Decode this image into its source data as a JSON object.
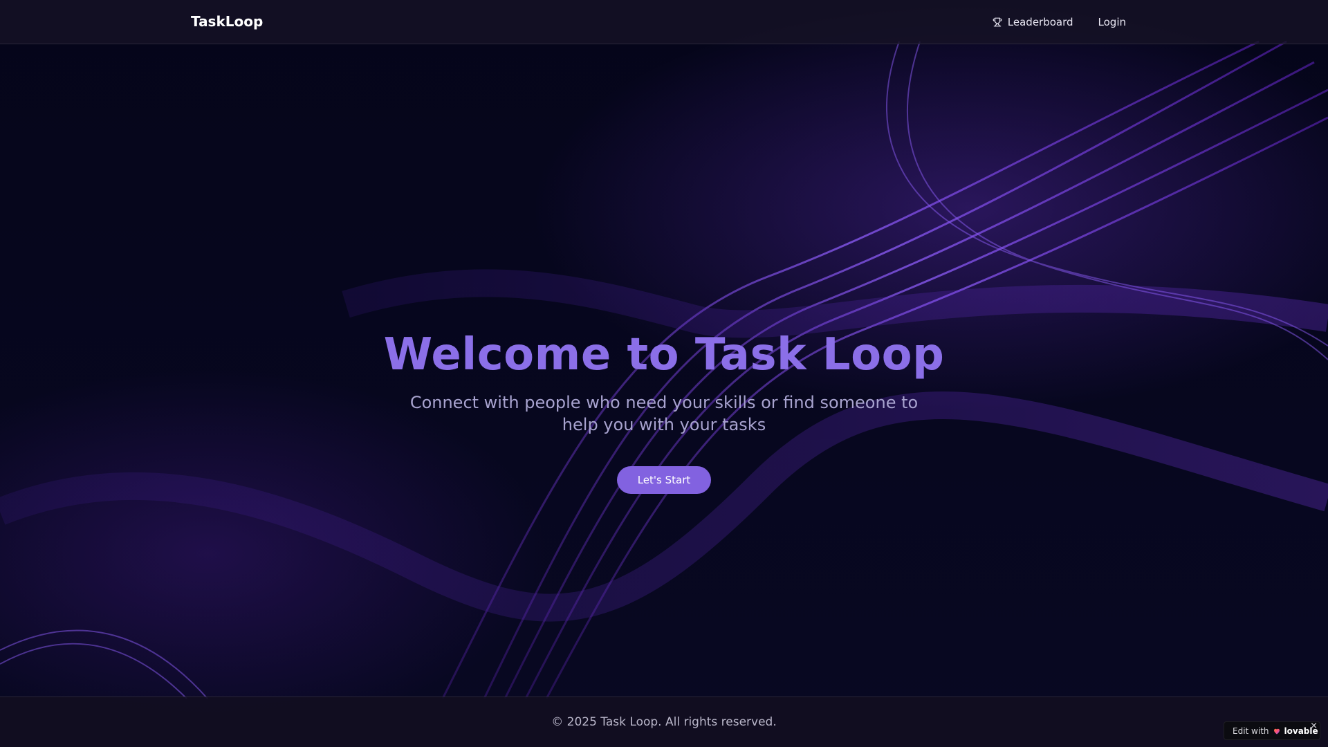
{
  "header": {
    "brand": "TaskLoop",
    "nav": [
      {
        "label": "Leaderboard",
        "icon": "trophy-icon"
      },
      {
        "label": "Login"
      }
    ]
  },
  "hero": {
    "title": "Welcome to Task Loop",
    "subtitle": "Connect with people who need your skills or find someone to help you with your tasks",
    "cta_label": "Let's Start"
  },
  "footer": {
    "copyright": "© 2025 Task Loop. All rights reserved."
  },
  "badge": {
    "prefix": "Edit with",
    "brand": "lovable",
    "icon": "heart-icon",
    "close": "×"
  },
  "colors": {
    "accent": "#8b6fe8",
    "button": "#8262e0",
    "background": "#06061a",
    "wave": "#7c3aed"
  }
}
